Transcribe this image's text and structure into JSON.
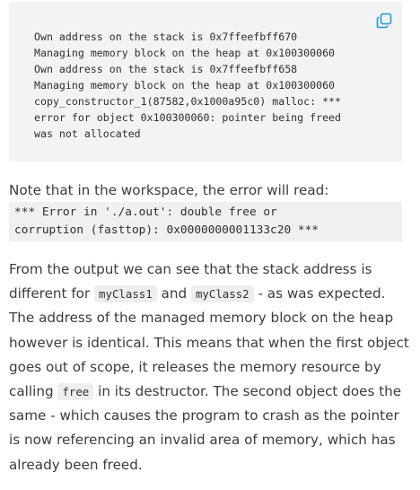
{
  "code_block": {
    "lines": [
      "Own address on the stack is 0x7ffeefbff670",
      "Managing memory block on the heap at 0x100300060",
      "Own address on the stack is 0x7ffeefbff658",
      "Managing memory block on the heap at 0x100300060",
      "copy_constructor_1(87582,0x1000a95c0) malloc: ***",
      "error for object 0x100300060: pointer being freed",
      "was not allocated"
    ]
  },
  "note": {
    "text": "Note that in the workspace, the error will read:"
  },
  "error_block": {
    "lines": [
      "*** Error in './a.out': double free or",
      "corruption (fasttop): 0x0000000001133c20 ***"
    ]
  },
  "paragraph": {
    "l1": "From the output we can see that the stack address is",
    "l2_a": "different for ",
    "code1": "myClass1",
    "l2_b": " and ",
    "code2": "myClass2",
    "l2_c": " - as was expected.",
    "l3": "The address of the managed memory block on the heap",
    "l4": "however is identical. This means that when the first object",
    "l5": "goes out of scope, it releases the memory resource by",
    "l6_a": "calling ",
    "code3": "free",
    "l6_b": " in its destructor. The second object does the",
    "l7": "same - which causes the program to crash as the pointer",
    "l8": "is now referencing an invalid area of memory, which has",
    "l9": "already been freed."
  },
  "colors": {
    "accent": "#1e9bd7",
    "code_bg": "#f3f3f3"
  },
  "icons": {
    "copy": "copy-icon"
  }
}
